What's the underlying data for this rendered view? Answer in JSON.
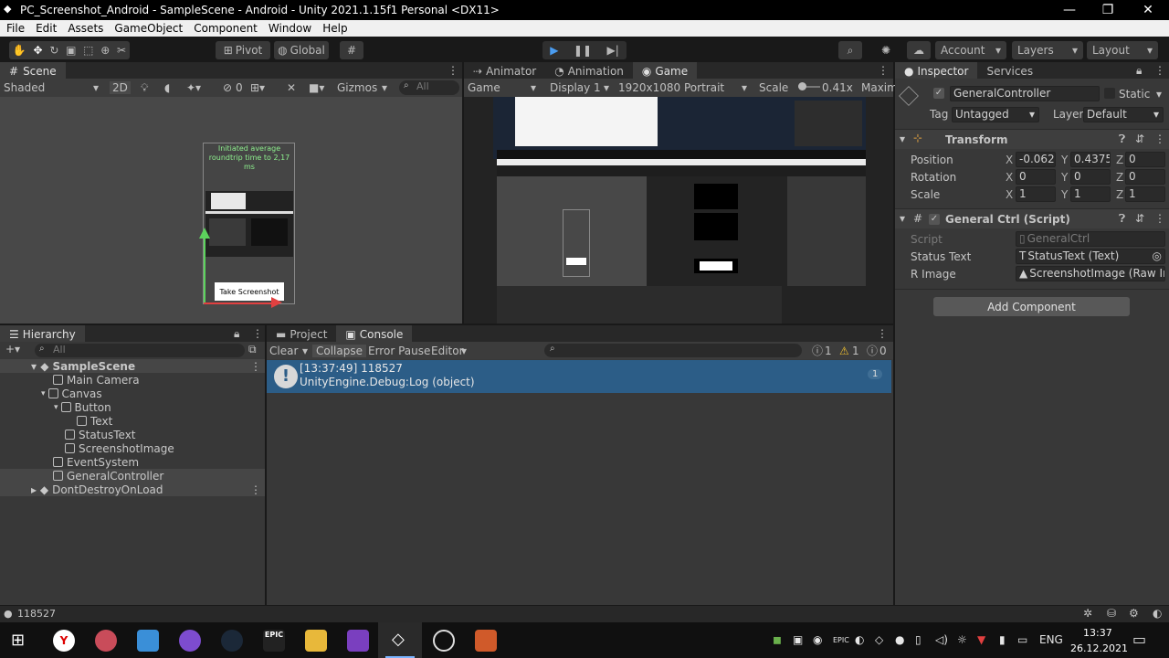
{
  "window": {
    "title": "PC_Screenshot_Android - SampleScene - Android - Unity 2021.1.15f1 Personal <DX11>",
    "minimize": "—",
    "maximize": "❐",
    "close": "✕"
  },
  "menu": [
    "File",
    "Edit",
    "Assets",
    "GameObject",
    "Component",
    "Window",
    "Help"
  ],
  "toolbar": {
    "pivot": "Pivot",
    "global": "Global",
    "account": "Account",
    "layers": "Layers",
    "layout": "Layout"
  },
  "scene": {
    "tab": "Scene",
    "shading": "Shaded",
    "mode2d": "2D",
    "hidden_count": "0",
    "gizmos": "Gizmos",
    "search_placeholder": "All",
    "canvas_text": "Initiated average roundtrip time to 2,17 ms",
    "button_text": "Take Screenshot"
  },
  "game": {
    "tabs": [
      "Animator",
      "Animation",
      "Game"
    ],
    "display_mode": "Game",
    "display": "Display 1",
    "resolution": "1920x1080 Portrait",
    "scale_label": "Scale",
    "scale_value": "0.41x",
    "maximize": "Maxim"
  },
  "inspector": {
    "tabs": [
      "Inspector",
      "Services"
    ],
    "object_name": "GeneralController",
    "static_label": "Static",
    "tag_label": "Tag",
    "tag_value": "Untagged",
    "layer_label": "Layer",
    "layer_value": "Default",
    "transform": {
      "title": "Transform",
      "position_label": "Position",
      "rotation_label": "Rotation",
      "scale_label": "Scale",
      "position": {
        "x": "-0.062!",
        "y": "0.4375",
        "z": "0"
      },
      "rotation": {
        "x": "0",
        "y": "0",
        "z": "0"
      },
      "scale": {
        "x": "1",
        "y": "1",
        "z": "1"
      }
    },
    "script_component": {
      "title": "General Ctrl (Script)",
      "script_label": "Script",
      "script_value": "GeneralCtrl",
      "status_label": "Status Text",
      "status_value": "StatusText (Text)",
      "rimage_label": "R Image",
      "rimage_value": "ScreenshotImage (Raw In"
    },
    "add_component": "Add Component"
  },
  "hierarchy": {
    "tab": "Hierarchy",
    "search_placeholder": "All",
    "items": [
      {
        "label": "SampleScene"
      },
      {
        "label": "Main Camera"
      },
      {
        "label": "Canvas"
      },
      {
        "label": "Button"
      },
      {
        "label": "Text"
      },
      {
        "label": "StatusText"
      },
      {
        "label": "ScreenshotImage"
      },
      {
        "label": "EventSystem"
      },
      {
        "label": "GeneralController"
      },
      {
        "label": "DontDestroyOnLoad"
      }
    ]
  },
  "console": {
    "tabs": [
      "Project",
      "Console"
    ],
    "clear": "Clear",
    "collapse": "Collapse",
    "error_pause": "Error Pause",
    "editor": "Editor",
    "log_count": "1",
    "warn_count": "1",
    "err_count": "0",
    "entry_line1": "[13:37:49] 118527",
    "entry_line2": "UnityEngine.Debug:Log (object)",
    "entry_count": "1"
  },
  "statusbar": {
    "message": "118527"
  },
  "taskbar": {
    "language": "ENG",
    "time": "13:37",
    "date": "26.12.2021"
  },
  "colors": {
    "selected_blue": "#2c5d87",
    "unity_dark": "#383838",
    "titlebar": "#000000"
  }
}
